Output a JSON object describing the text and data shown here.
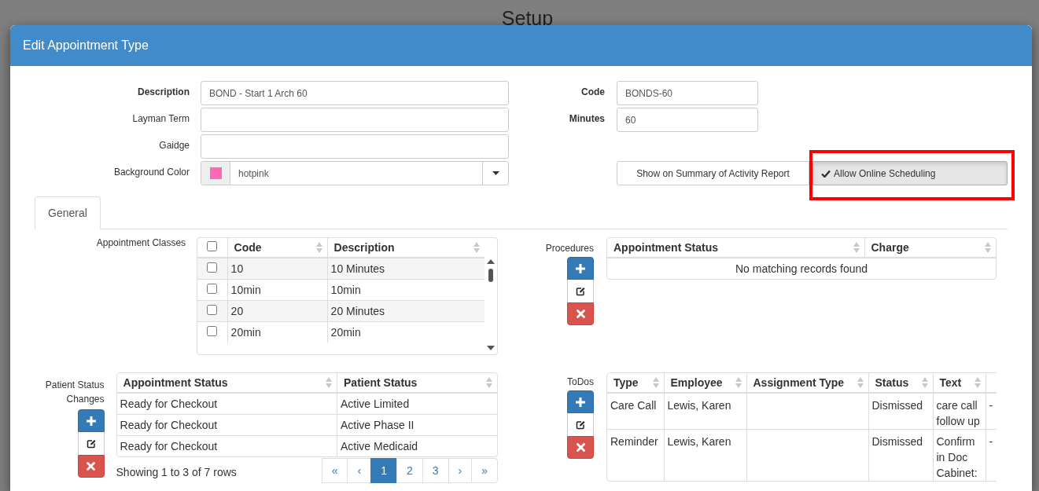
{
  "background": {
    "title": "Setup"
  },
  "modal": {
    "title": "Edit Appointment Type",
    "fields": [
      {
        "label": "Description",
        "required": true,
        "value": "BOND - Start 1 Arch 60"
      },
      {
        "label": "Layman Term",
        "required": false
      },
      {
        "label": "Gaidge",
        "required": false
      }
    ],
    "background_color": {
      "label": "Background Color",
      "value": "hotpink",
      "color": "#ff69b4"
    },
    "right_fields": [
      {
        "label": "Code",
        "required": true,
        "value": "BONDS-60"
      },
      {
        "label": "Minutes",
        "required": true,
        "value": "60"
      }
    ],
    "toggles": [
      {
        "label": "Show on Summary of Activity Report",
        "on": false,
        "highlighted": false
      },
      {
        "label": "Allow Online Scheduling",
        "on": true,
        "highlighted": true
      }
    ],
    "tabs": [
      {
        "label": "General",
        "selected": true
      }
    ],
    "appointment_classes": {
      "label": "Appointment Classes",
      "all_checked": false,
      "columns": [
        "Code",
        "Description"
      ],
      "rows": [
        {
          "code": "10",
          "description": "10 Minutes",
          "checked": false
        },
        {
          "code": "10min",
          "description": "10min",
          "checked": false
        },
        {
          "code": "20",
          "description": "20 Minutes",
          "checked": false
        },
        {
          "code": "20min",
          "description": "20min",
          "checked": false
        }
      ]
    },
    "procedures": {
      "label": "Procedures",
      "columns": [
        "Appointment Status",
        "Charge"
      ],
      "empty_message": "No matching records found"
    },
    "patient_status_changes": {
      "label": "Patient Status Changes",
      "columns": [
        "Appointment Status",
        "Patient Status"
      ],
      "rows": [
        [
          "Ready for Checkout",
          "Active Limited"
        ],
        [
          "Ready for Checkout",
          "Active Phase II"
        ],
        [
          "Ready for Checkout",
          "Active Medicaid"
        ]
      ],
      "summary": "Showing 1 to 3 of 7 rows",
      "pages": [
        {
          "label": "«",
          "selected": false
        },
        {
          "label": "‹",
          "selected": false
        },
        {
          "label": "1",
          "selected": true
        },
        {
          "label": "2",
          "selected": false
        },
        {
          "label": "3",
          "selected": false
        },
        {
          "label": "›",
          "selected": false
        },
        {
          "label": "»",
          "selected": false
        }
      ]
    },
    "todos": {
      "label": "ToDos",
      "columns": [
        "Type",
        "Employee",
        "Assignment Type",
        "Status",
        "Text"
      ],
      "rows": [
        {
          "type": "Care Call",
          "employee": "Lewis, Karen",
          "status": "Dismissed",
          "text": "care call follow up",
          "column_6": "-"
        },
        {
          "type": "Reminder",
          "employee": "Lewis, Karen",
          "status": "Dismissed",
          "text": "Confirm in Doc Cabinet:",
          "column_6": "-"
        }
      ]
    }
  }
}
